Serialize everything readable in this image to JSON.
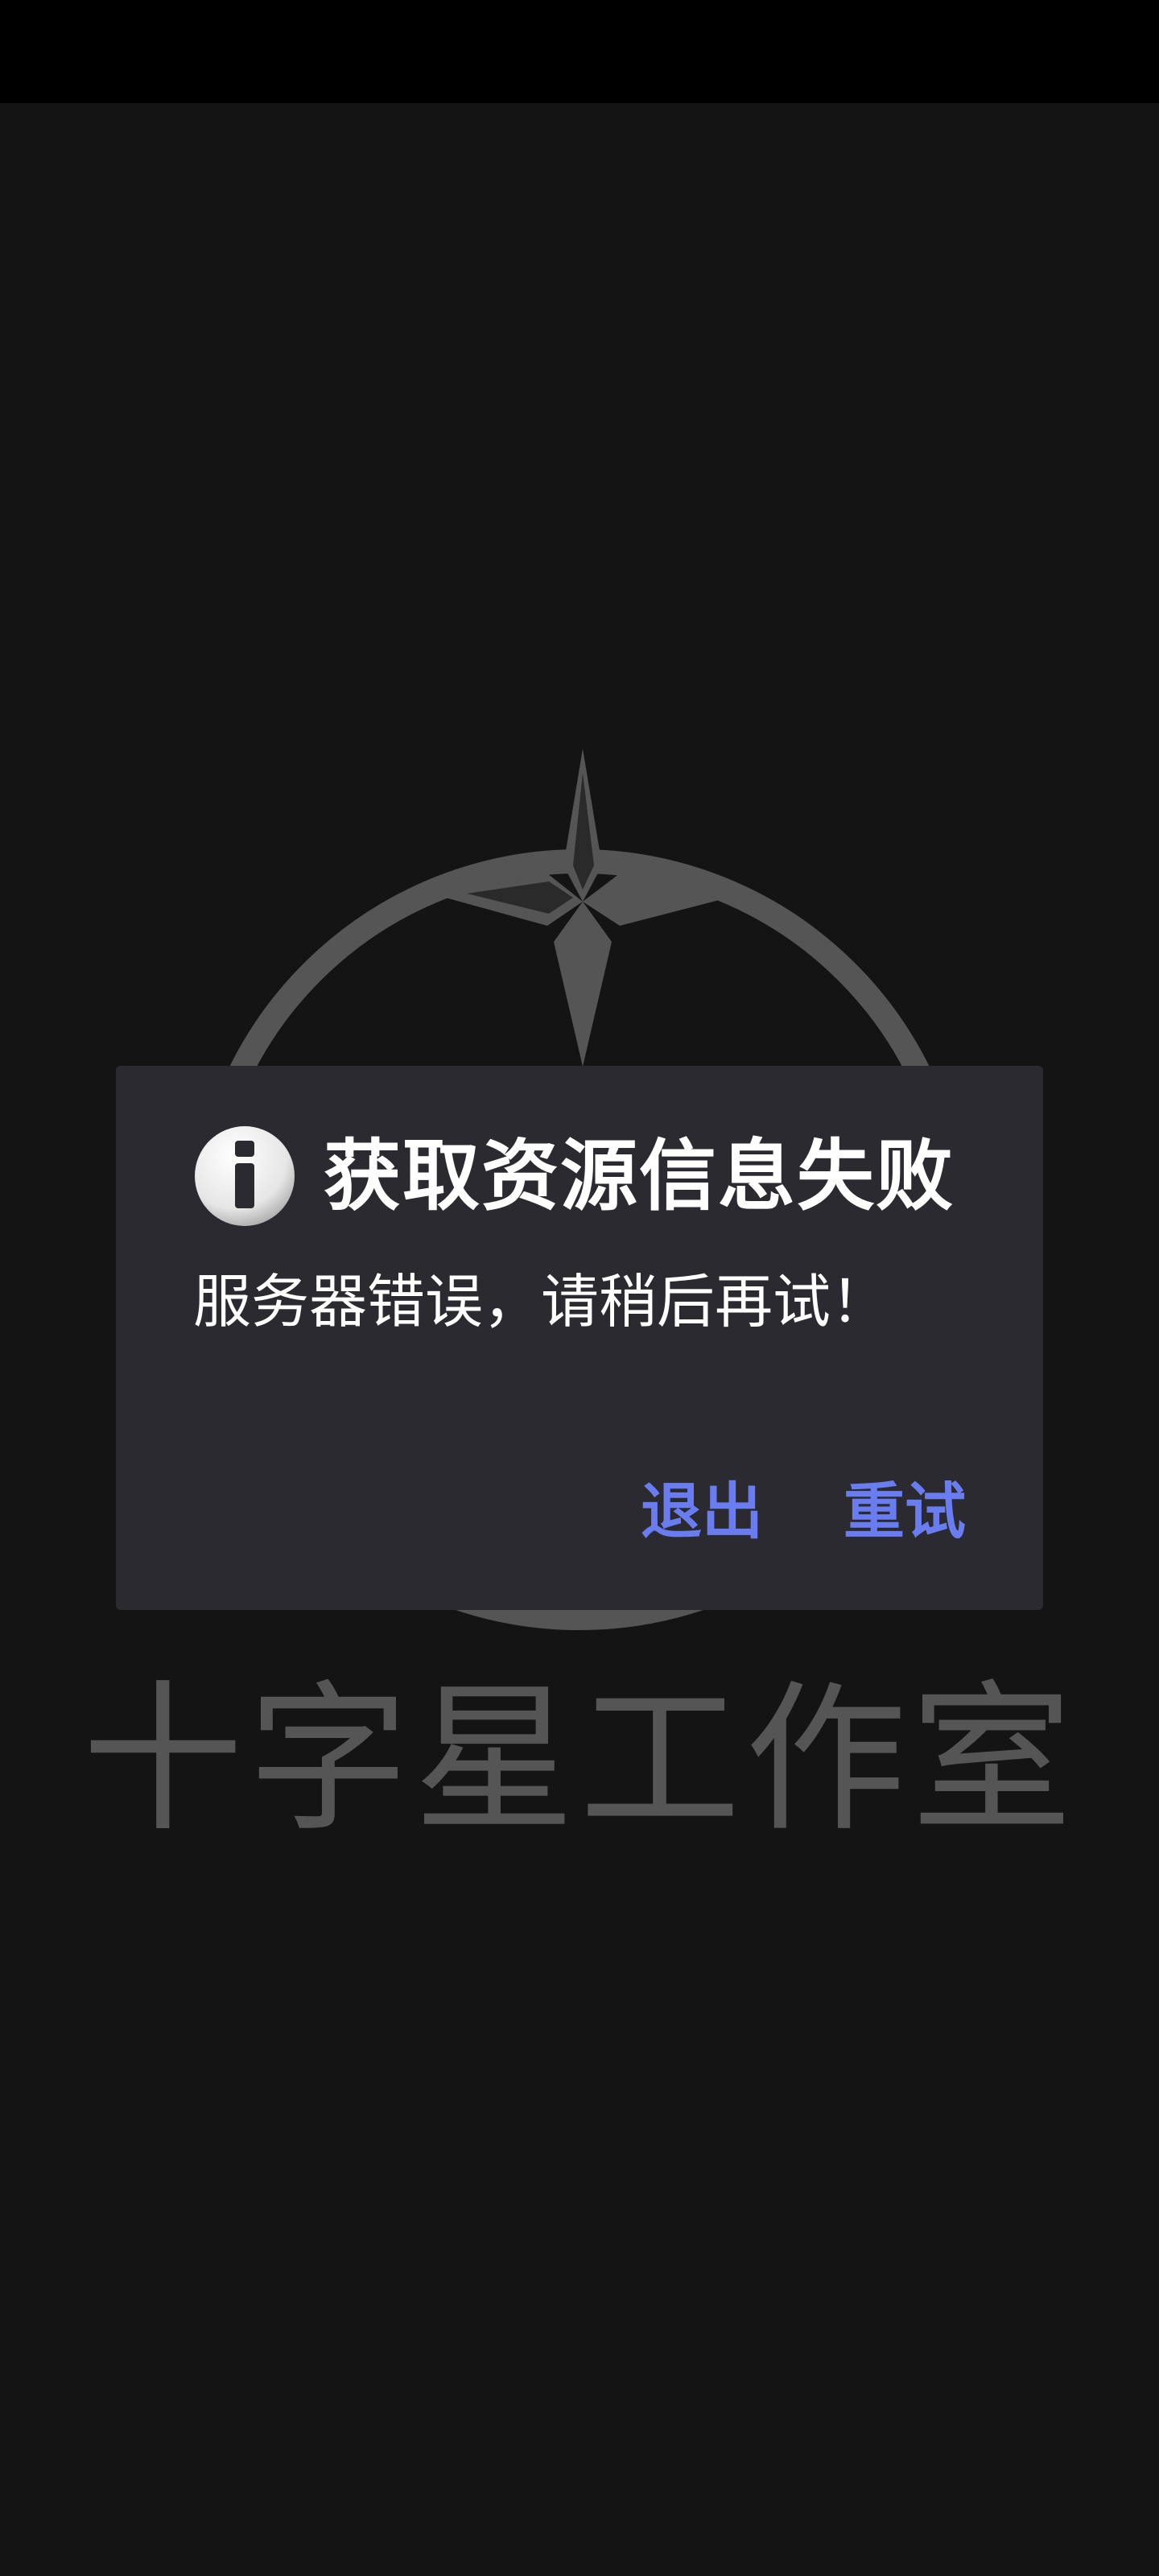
{
  "dialog": {
    "title": "获取资源信息失败",
    "message": "服务器错误，请稍后再试！",
    "exit_label": "退出",
    "retry_label": "重试"
  },
  "splash": {
    "studio_name": "十字星工作室"
  },
  "colors": {
    "background": "#141414",
    "status_bar": "#000000",
    "dialog_bg": "#2b2a30",
    "accent": "#6a7df0",
    "logo": "#555555"
  },
  "icons": {
    "dialog_icon": "info-icon",
    "logo": "crossstar-logo"
  }
}
